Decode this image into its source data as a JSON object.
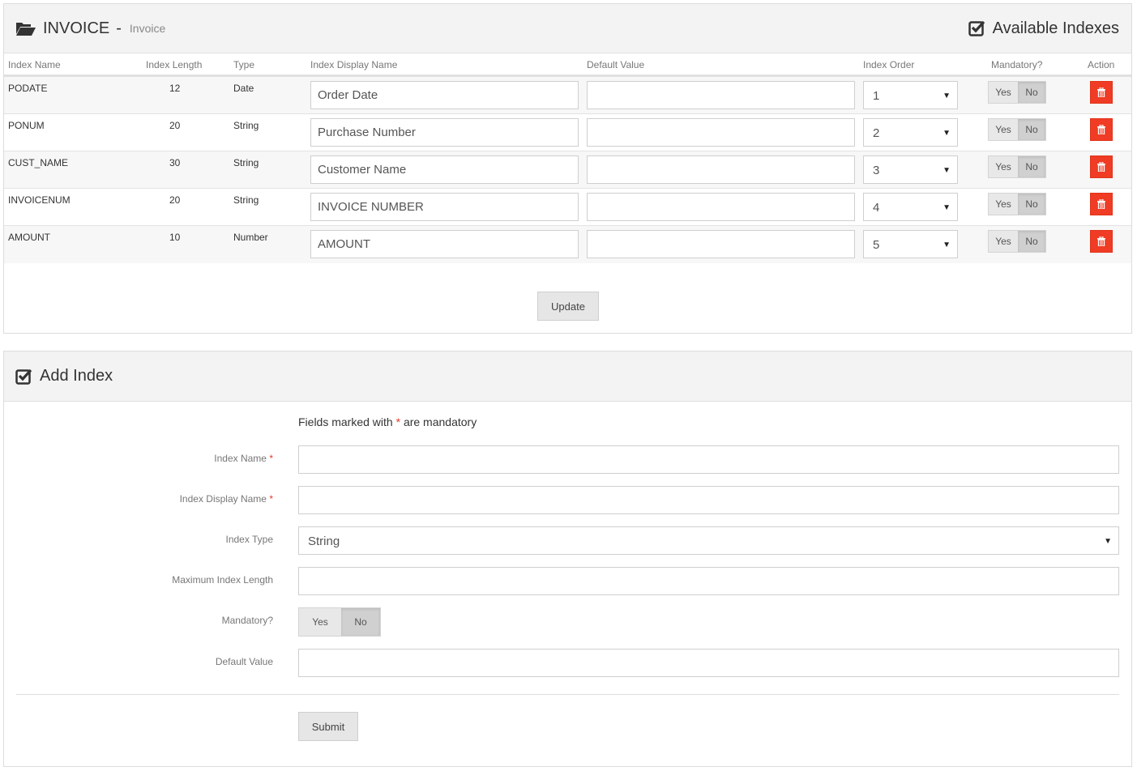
{
  "indexes_panel": {
    "title": "INVOICE",
    "separator": "-",
    "subtitle": "Invoice",
    "right_title": "Available Indexes",
    "columns": [
      "Index Name",
      "Index Length",
      "Type",
      "Index Display Name",
      "Default Value",
      "Index Order",
      "Mandatory?",
      "Action"
    ],
    "rows": [
      {
        "name": "PODATE",
        "length": "12",
        "type": "Date",
        "display_name": "Order Date",
        "default_value": "",
        "order": "1",
        "mandatory": "No"
      },
      {
        "name": "PONUM",
        "length": "20",
        "type": "String",
        "display_name": "Purchase Number",
        "default_value": "",
        "order": "2",
        "mandatory": "No"
      },
      {
        "name": "CUST_NAME",
        "length": "30",
        "type": "String",
        "display_name": "Customer Name",
        "default_value": "",
        "order": "3",
        "mandatory": "No"
      },
      {
        "name": "INVOICENUM",
        "length": "20",
        "type": "String",
        "display_name": "INVOICE NUMBER",
        "default_value": "",
        "order": "4",
        "mandatory": "No"
      },
      {
        "name": "AMOUNT",
        "length": "10",
        "type": "Number",
        "display_name": "AMOUNT",
        "default_value": "",
        "order": "5",
        "mandatory": "No"
      }
    ],
    "toggle_yes": "Yes",
    "toggle_no": "No",
    "update_label": "Update",
    "delete_color": "#f03c24"
  },
  "add_panel": {
    "title": "Add Index",
    "hint_prefix": "Fields marked with",
    "hint_star": "*",
    "hint_suffix": "are mandatory",
    "fields": {
      "index_name_label": "Index Name",
      "index_name_value": "",
      "display_name_label": "Index Display Name",
      "display_name_value": "",
      "type_label": "Index Type",
      "type_value": "String",
      "max_length_label": "Maximum Index Length",
      "max_length_value": "",
      "mandatory_label": "Mandatory?",
      "mandatory_yes": "Yes",
      "mandatory_no": "No",
      "mandatory_value": "No",
      "default_label": "Default Value",
      "default_value": ""
    },
    "required_star": "*",
    "submit_label": "Submit"
  }
}
